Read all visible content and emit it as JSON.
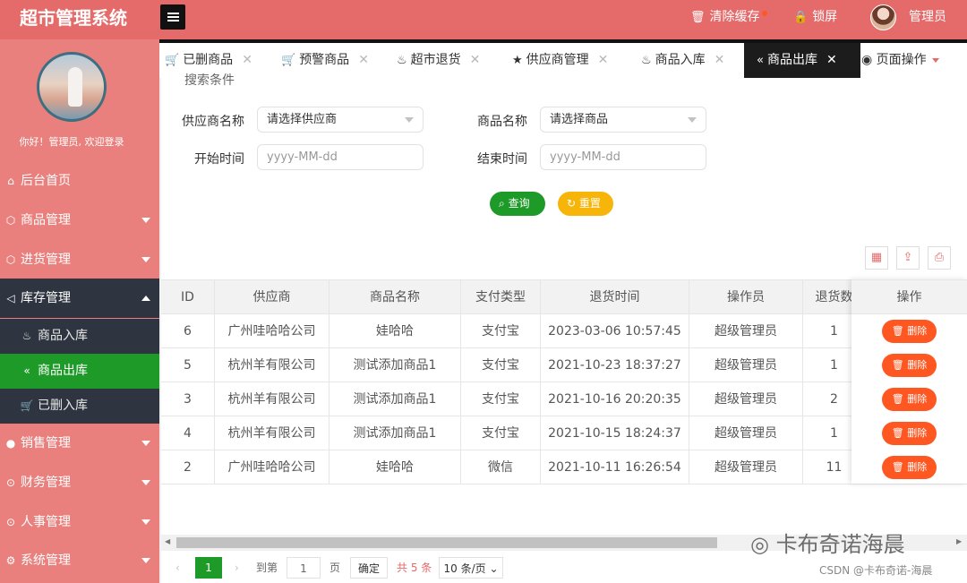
{
  "app": {
    "title": "超市管理系统",
    "clear_cache": "清除缓存",
    "lock": "锁屏",
    "user": "管理员"
  },
  "sidebar": {
    "greeting": "你好！管理员, 欢迎登录",
    "items": [
      {
        "label": "后台首页",
        "icon": "home-icon"
      },
      {
        "label": "商品管理",
        "icon": "cube-icon"
      },
      {
        "label": "进货管理",
        "icon": "cube-icon"
      },
      {
        "label": "库存管理",
        "icon": "volume-icon"
      },
      {
        "label": "销售管理",
        "icon": "chat-icon"
      },
      {
        "label": "财务管理",
        "icon": "target-icon"
      },
      {
        "label": "人事管理",
        "icon": "target-icon"
      },
      {
        "label": "系统管理",
        "icon": "gear-icon"
      }
    ],
    "sub_items": [
      {
        "label": "商品入库",
        "icon": "fire-icon"
      },
      {
        "label": "商品出库",
        "icon": "double-chevron-left-icon"
      },
      {
        "label": "已删入库",
        "icon": "cart-icon"
      }
    ]
  },
  "tabs": [
    {
      "label": "已删商品",
      "icon": "cart-icon"
    },
    {
      "label": "预警商品",
      "icon": "cart-icon"
    },
    {
      "label": "超市退货",
      "icon": "fire-icon"
    },
    {
      "label": "供应商管理",
      "icon": "star-icon"
    },
    {
      "label": "商品入库",
      "icon": "fire-icon"
    },
    {
      "label": "商品出库",
      "icon": "double-chevron-left-icon"
    }
  ],
  "page_ops": "页面操作",
  "search": {
    "legend": "搜索条件",
    "supplier_label": "供应商名称",
    "supplier_value": "请选择供应商",
    "product_label": "商品名称",
    "product_value": "请选择商品",
    "start_label": "开始时间",
    "start_placeholder": "yyyy-MM-dd",
    "end_label": "结束时间",
    "end_placeholder": "yyyy-MM-dd",
    "query_btn": "查询",
    "reset_btn": "重置"
  },
  "table": {
    "columns": [
      "ID",
      "供应商",
      "商品名称",
      "支付类型",
      "退货时间",
      "操作员",
      "退货数"
    ],
    "ops_header": "操作",
    "delete_label": "删除",
    "rows": [
      [
        "6",
        "广州哇哈哈公司",
        "娃哈哈",
        "支付宝",
        "2023-03-06 10:57:45",
        "超级管理员",
        "1"
      ],
      [
        "5",
        "杭州羊有限公司",
        "测试添加商品1",
        "支付宝",
        "2021-10-23 18:37:27",
        "超级管理员",
        "1"
      ],
      [
        "3",
        "杭州羊有限公司",
        "测试添加商品1",
        "支付宝",
        "2021-10-16 20:20:35",
        "超级管理员",
        "2"
      ],
      [
        "4",
        "杭州羊有限公司",
        "测试添加商品1",
        "支付宝",
        "2021-10-15 18:24:37",
        "超级管理员",
        "1"
      ],
      [
        "2",
        "广州哇哈哈公司",
        "娃哈哈",
        "微信",
        "2021-10-11 16:26:54",
        "超级管理员",
        "11"
      ]
    ]
  },
  "pager": {
    "current": "1",
    "goto_label": "到第",
    "goto_value": "1",
    "page_unit": "页",
    "confirm": "确定",
    "total": "共 5 条",
    "page_size": "10 条/页"
  },
  "watermark": "卡布奇诺海晨",
  "csdn": "CSDN @卡布奇诺-海晨",
  "colors": {
    "header": "#e46b6a",
    "sidebar": "#e9807d",
    "active_green": "#1e9a28",
    "reset_yellow": "#f7b50a",
    "danger": "#ff5722"
  }
}
